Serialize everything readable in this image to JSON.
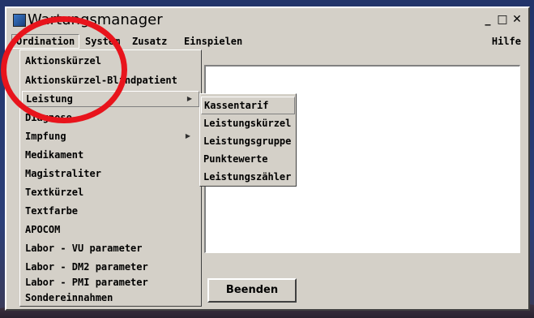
{
  "window": {
    "title": "Wartungsmanager"
  },
  "window_controls": {
    "minimize": "_",
    "maximize": "□",
    "close": "✕"
  },
  "menubar": {
    "items": [
      "Ordination",
      "System",
      "Zusatz",
      "Einspielen"
    ],
    "help": "Hilfe"
  },
  "dropdown": {
    "items": [
      "Aktionskürzel",
      "Aktionskürzel-Blindpatient",
      "Leistung",
      "Diagnose",
      "Impfung",
      "Medikament",
      "Magistraliter",
      "Textkürzel",
      "Textfarbe",
      "APOCOM",
      "Labor - VU parameter",
      "Labor - DM2 parameter",
      "Labor - PMI parameter",
      "Sondereinnahmen"
    ],
    "highlighted": "Leistung"
  },
  "submenu": {
    "items": [
      "Kassentarif",
      "Leistungskürzel",
      "Leistungsgruppe",
      "Punktewerte",
      "Leistungszähler"
    ],
    "highlighted": "Kassentarif"
  },
  "buttons": {
    "quit": "Beenden"
  },
  "icons": {
    "app": "app-icon",
    "submenu_arrow": "chevron-right-icon",
    "annotation": "red-circle-annotation"
  },
  "colors": {
    "window_bg": "#d4d0c8",
    "annotation": "#e8141c",
    "pane_bg": "#ffffff"
  }
}
